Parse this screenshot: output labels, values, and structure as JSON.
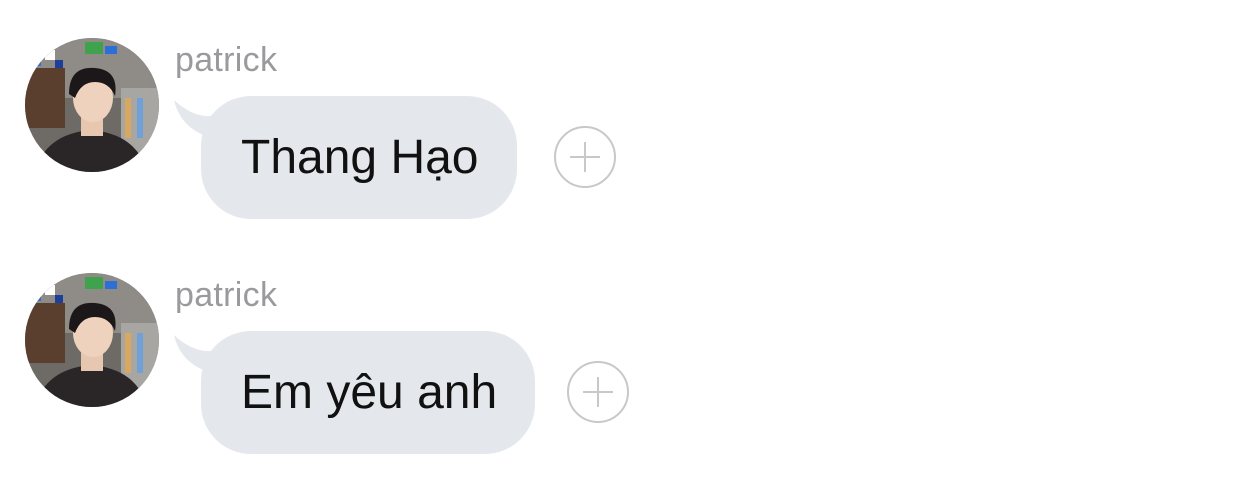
{
  "messages": [
    {
      "sender": "patrick",
      "text": "Thang Hạo",
      "avatar_icon": "user-avatar",
      "reaction_icon": "add-reaction-icon"
    },
    {
      "sender": "patrick",
      "text": "Em yêu anh",
      "avatar_icon": "user-avatar",
      "reaction_icon": "add-reaction-icon"
    }
  ],
  "colors": {
    "bubble": "#e4e8ec",
    "sender": "#9a9a9e",
    "text": "#111111",
    "reaction_outline": "#c8c8cb",
    "background": "#ffffff"
  }
}
